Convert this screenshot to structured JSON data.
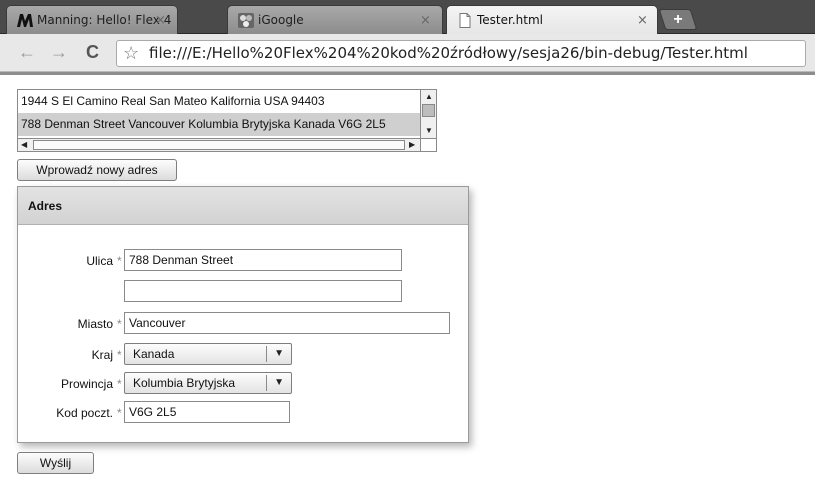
{
  "browser": {
    "tabs": [
      {
        "label": "Manning: Hello! Flex 4",
        "icon": "manning-logo-icon",
        "active": false
      },
      {
        "label": "iGoogle",
        "icon": "igoogle-icon",
        "active": false
      },
      {
        "label": "Tester.html",
        "icon": "page-icon",
        "active": true
      }
    ],
    "new_tab_symbol": "+",
    "close_symbol": "×",
    "back_symbol": "←",
    "forward_symbol": "→",
    "reload_symbol": "C",
    "star_symbol": "☆",
    "url": "file:///E:/Hello%20Flex%204%20kod%20źródłowy/sesja26/bin-debug/Tester.html"
  },
  "address_list": {
    "items": [
      "1944 S El Camino Real San Mateo Kalifornia USA 94403",
      "788 Denman Street Vancouver Kolumbia Brytyjska Kanada V6G 2L5"
    ],
    "selected_index": 1
  },
  "new_address_button": "Wprowadź nowy adres",
  "form": {
    "title": "Adres",
    "required_marker": "*",
    "street_label": "Ulica",
    "street_value": "788 Denman Street",
    "street2_value": "",
    "city_label": "Miasto",
    "city_value": "Vancouver",
    "country_label": "Kraj",
    "country_value": "Kanada",
    "province_label": "Prowincja",
    "province_value": "Kolumbia Brytyjska",
    "postal_label": "Kod poczt.",
    "postal_value": "V6G 2L5"
  },
  "submit_button": "Wyślij",
  "colors": {
    "selection": "#cfcfcf",
    "panel_header": "#d9d9d9",
    "tabstrip": "#4a4a4a"
  }
}
